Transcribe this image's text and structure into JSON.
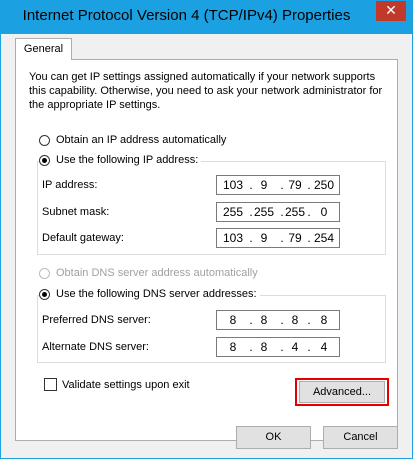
{
  "window": {
    "title": "Internet Protocol Version 4 (TCP/IPv4) Properties",
    "close": "✕"
  },
  "tabs": [
    {
      "label": "General"
    }
  ],
  "description": "You can get IP settings assigned automatically if your network supports this capability. Otherwise, you need to ask your network administrator for the appropriate IP settings.",
  "ip": {
    "auto_label": "Obtain an IP address automatically",
    "manual_label": "Use the following IP address:",
    "selected": "manual",
    "fields": [
      {
        "label": "IP address:",
        "octets": [
          "103",
          "9",
          "79",
          "250"
        ]
      },
      {
        "label": "Subnet mask:",
        "octets": [
          "255",
          "255",
          "255",
          "0"
        ]
      },
      {
        "label": "Default gateway:",
        "octets": [
          "103",
          "9",
          "79",
          "254"
        ]
      }
    ]
  },
  "dns": {
    "auto_label": "Obtain DNS server address automatically",
    "manual_label": "Use the following DNS server addresses:",
    "selected": "manual",
    "fields": [
      {
        "label": "Preferred DNS server:",
        "octets": [
          "8",
          "8",
          "8",
          "8"
        ]
      },
      {
        "label": "Alternate DNS server:",
        "octets": [
          "8",
          "8",
          "4",
          "4"
        ]
      }
    ]
  },
  "validate_label": "Validate settings upon exit",
  "buttons": {
    "advanced": "Advanced...",
    "ok": "OK",
    "cancel": "Cancel"
  },
  "colors": {
    "titlebar": "#1ba1e2",
    "highlight": "#e30000"
  }
}
